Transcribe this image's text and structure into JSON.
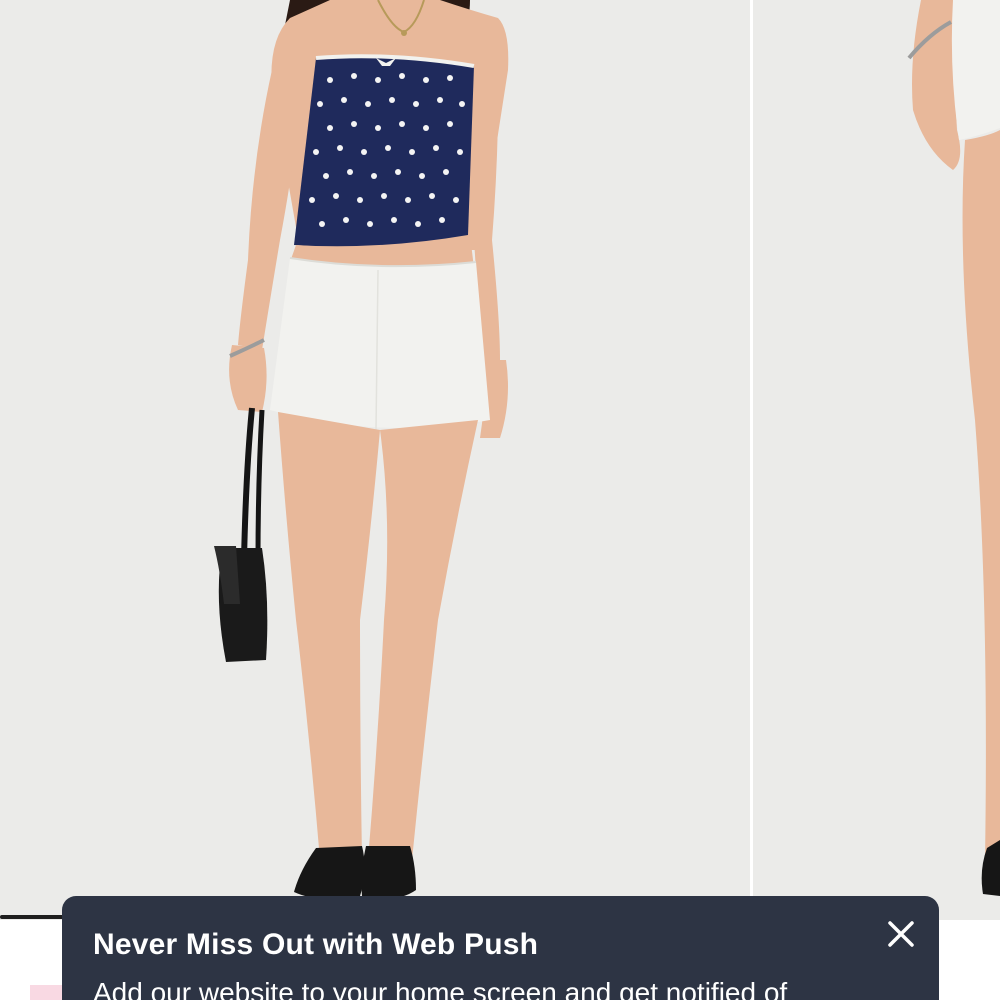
{
  "carousel": {
    "slide_1_alt": "Model wearing navy polka dot strapless top and white mini skirt",
    "slide_2_alt": "Model wearing white mini skirt, side view",
    "progress_fraction": 0.265,
    "colors": {
      "background": "#ebebe9",
      "top_navy": "#1f2a5c",
      "skirt_white": "#f2f2ef",
      "skin": "#e8b89a",
      "hair": "#2a1a14",
      "shoes": "#161616"
    }
  },
  "push_banner": {
    "title": "Never Miss Out with Web Push",
    "body": "Add our website to your home screen and get notified of",
    "close_icon": "close-icon",
    "background_color": "#2d3444"
  }
}
